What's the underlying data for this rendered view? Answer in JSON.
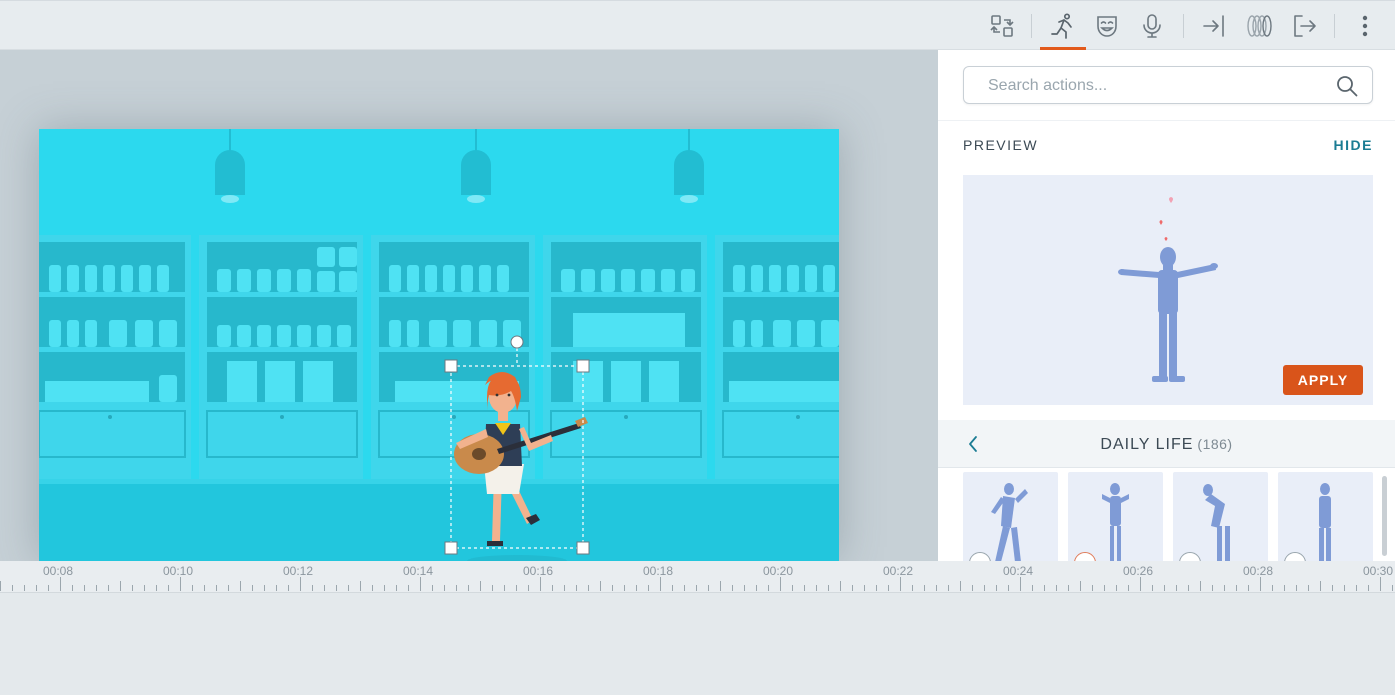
{
  "toolbar": {
    "icons": [
      {
        "name": "swap-icon",
        "active": false
      },
      {
        "name": "action-run-icon",
        "active": true
      },
      {
        "name": "expression-mask-icon",
        "active": false
      },
      {
        "name": "microphone-icon",
        "active": false
      },
      {
        "name": "enter-icon",
        "active": false
      },
      {
        "name": "motion-rings-icon",
        "active": false
      },
      {
        "name": "exit-icon",
        "active": false
      },
      {
        "name": "more-vertical-icon",
        "active": false
      }
    ],
    "accent_color": "#e25a1c"
  },
  "panel": {
    "search_placeholder": "Search actions...",
    "preview_label": "PREVIEW",
    "hide_label": "HIDE",
    "apply_label": "APPLY",
    "category_title": "DAILY LIFE",
    "category_count": "(186)"
  },
  "timeline": {
    "ticks": [
      "00:08",
      "00:10",
      "00:12",
      "00:14",
      "00:16",
      "00:18",
      "00:20",
      "00:22",
      "00:24",
      "00:26",
      "00:28",
      "00:30"
    ]
  },
  "colors": {
    "canvas_bg": "#2cd9ee",
    "apply_button": "#d9541a",
    "link": "#1b7c93",
    "figure": "#7f9bd6"
  }
}
